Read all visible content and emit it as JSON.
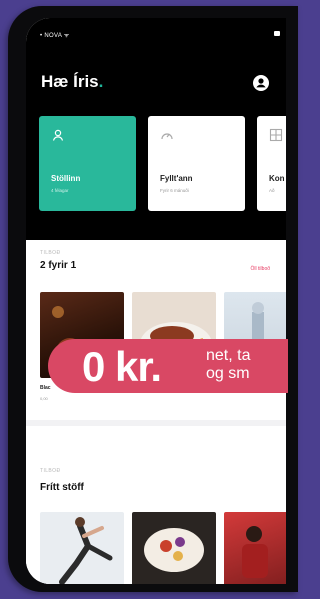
{
  "status": {
    "carrier": "• NOVA ᯤ"
  },
  "header": {
    "greeting": "Hæ Íris",
    "greeting_dot": "."
  },
  "cards": [
    {
      "title": "Stöllinn",
      "subtitle": "4 félagar"
    },
    {
      "title": "Fyllt'ann",
      "subtitle": "Fyrir 6 mánuði"
    },
    {
      "title": "Kon",
      "subtitle": "Að"
    }
  ],
  "section1": {
    "eyebrow": "TILBOÐ",
    "title": "2 fyrir 1",
    "see_all": "Öll tilboð",
    "item_caption": "Blac",
    "item_sub": "0,00"
  },
  "section2": {
    "eyebrow": "TILBOÐ",
    "title": "Frítt stöff"
  },
  "promo": {
    "big": "0 kr.",
    "line1": "net, ta",
    "line2": "og sm"
  },
  "colors": {
    "accent": "#29b89b",
    "promo": "#d94864",
    "link": "#e83c63"
  }
}
